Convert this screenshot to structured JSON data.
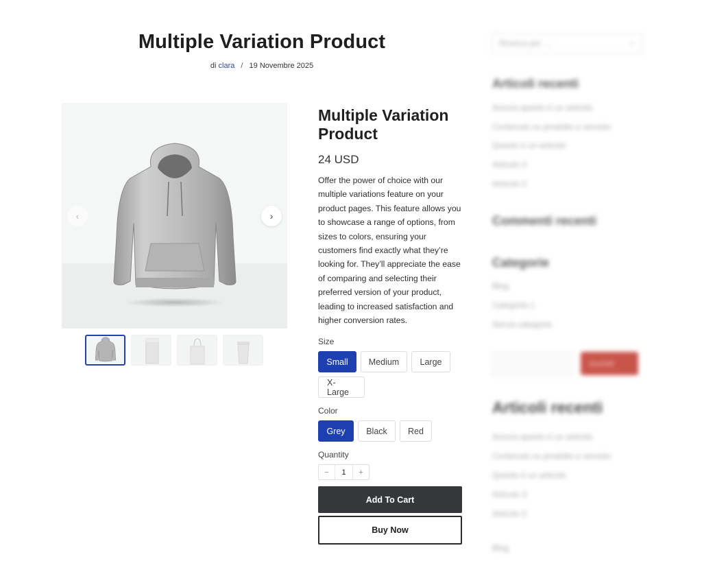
{
  "page": {
    "title": "Multiple Variation Product",
    "meta_prefix": "di",
    "author": "clara",
    "separator": "/",
    "date": "19 Novembre 2025"
  },
  "gallery": {
    "prev_icon": "chevron-left-icon",
    "next_icon": "chevron-right-icon",
    "prev_glyph": "‹",
    "next_glyph": "›",
    "thumbnails": [
      "hoodie",
      "paper-bag-front",
      "paper-bag-handles",
      "paper-cup"
    ],
    "active_thumbnail": 0
  },
  "product": {
    "title": "Multiple Variation Product",
    "price": "24 USD",
    "description": "Offer the power of choice with our multiple variations feature on your product pages. This feature allows you to showcase a range of options, from sizes to colors, ensuring your customers find exactly what they’re looking for. They’ll appreciate the ease of comparing and selecting their preferred version of your product, leading to increased satisfaction and higher conversion rates.",
    "size": {
      "label": "Size",
      "options": [
        "Small",
        "Medium",
        "Large",
        "X-Large"
      ],
      "selected": "Small"
    },
    "color": {
      "label": "Color",
      "options": [
        "Grey",
        "Black",
        "Red"
      ],
      "selected": "Grey"
    },
    "quantity": {
      "label": "Quantity",
      "minus": "−",
      "value": "1",
      "plus": "+"
    },
    "add_to_cart": "Add To Cart",
    "buy_now": "Buy Now"
  },
  "sidebar": {
    "search_placeholder": "Ricerca per …",
    "recent_posts_title": "Articoli recenti",
    "recent_posts": [
      "Ancora questo è un articolo",
      "Contenuto su prodotto e servizio",
      "Questo è un articolo",
      "Articolo 3",
      "Articolo 2"
    ],
    "recent_comments_title": "Commenti recenti",
    "categories_title": "Categorie",
    "categories": [
      "Blog",
      "Categoria 1",
      "Senza categoria"
    ],
    "subscribe_button": "Iscriviti",
    "recent_posts_title_2": "Articoli recenti",
    "recent_posts_2": [
      "Ancora questo è un articolo",
      "Contenuto su prodotto e servizio",
      "Questo è un articolo",
      "Articolo 3",
      "Articolo 2"
    ],
    "footer_link": "Blog"
  },
  "colors": {
    "accent": "#1d3fb0",
    "cart_button": "#35373a",
    "link": "#2b4aa8",
    "sidebar_button": "#c9544a"
  }
}
